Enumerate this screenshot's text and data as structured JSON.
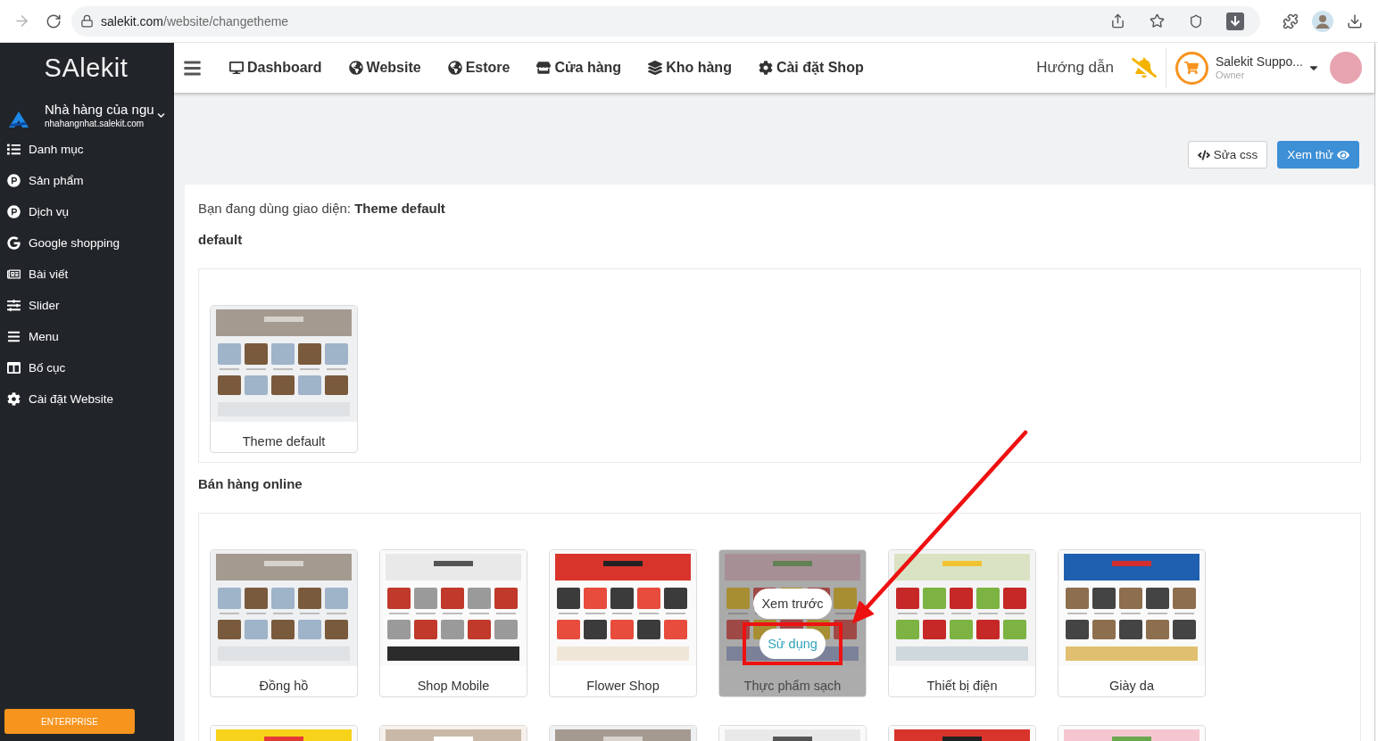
{
  "browser": {
    "url": {
      "host": "salekit.com",
      "path": "/website/changetheme"
    }
  },
  "sidebar": {
    "logo": "SAlekit",
    "store": {
      "name": "Nhà hàng của ngu",
      "domain": "nhahangnhat.salekit.com"
    },
    "items": [
      "Danh mục",
      "Sản phẩm",
      "Dịch vụ",
      "Google shopping",
      "Bài viết",
      "Slider",
      "Menu",
      "Bố cục",
      "Cài đặt Website"
    ],
    "plan": "ENTERPRISE"
  },
  "topbar": {
    "nav": [
      "Dashboard",
      "Website",
      "Estore",
      "Cửa hàng",
      "Kho hàng",
      "Cài đặt Shop"
    ],
    "help": "Hướng dẫn",
    "user": {
      "name": "Salekit Suppo...",
      "role": "Owner"
    }
  },
  "toolbar": {
    "buttons": [
      {
        "label": "Sửa css",
        "kind": "code"
      },
      {
        "label": "Xem thử",
        "kind": "preview"
      }
    ]
  },
  "current_theme": "Bạn đang dùng giao diện: **Theme default**",
  "groups": [
    {
      "title": "default",
      "themes": [
        {
          "label": "Theme default",
          "hovered": false
        }
      ]
    },
    {
      "title": "Bán hàng online",
      "themes": [
        {
          "label": "Đồng hồ",
          "hovered": false
        },
        {
          "label": "Shop Mobile",
          "hovered": false
        },
        {
          "label": "Flower Shop",
          "hovered": false
        },
        {
          "label": "Thực phẩm sạch",
          "hovered": true,
          "actions": [
            {
              "label": "Xem trước",
              "highlighted": false
            },
            {
              "label": "Sử dụng",
              "highlighted": true
            }
          ]
        },
        {
          "label": "Thiết bị điện",
          "hovered": false
        },
        {
          "label": "Giày da",
          "hovered": false
        },
        {
          "hovered": false
        },
        {
          "hovered": false
        },
        {
          "hovered": false
        },
        {
          "hovered": false
        },
        {
          "hovered": false
        },
        {
          "hovered": false
        }
      ]
    }
  ]
}
